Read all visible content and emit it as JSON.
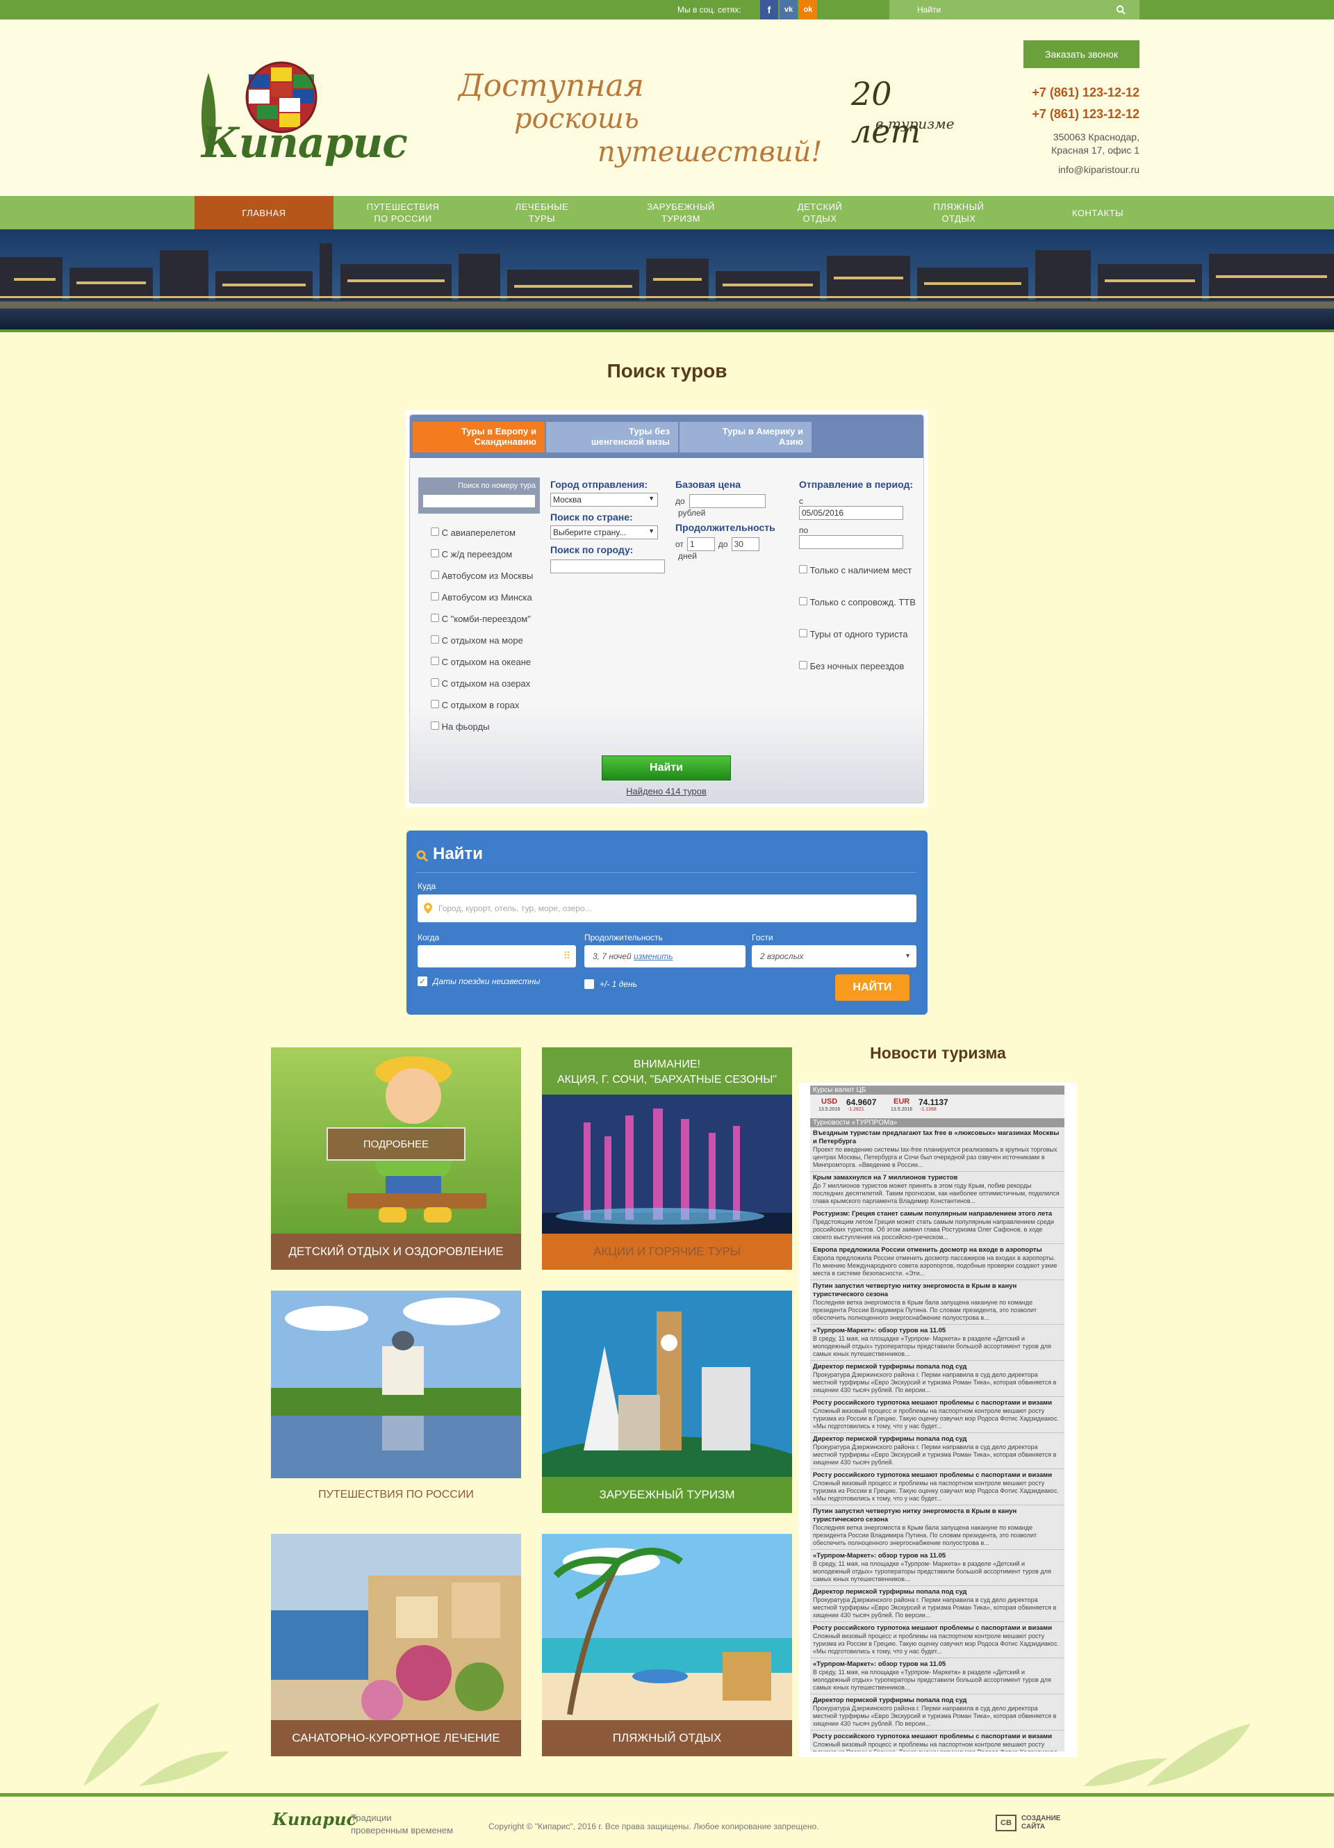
{
  "topbar": {
    "social_label": "Мы в соц. сетях:",
    "search_placeholder": "Найти"
  },
  "header": {
    "logo_text": "Кипарис",
    "slogan_lines": [
      "Доступная",
      "роскошь",
      "путешествий!"
    ],
    "years_badge_main": "20 лет",
    "years_badge_sub": "в туризме",
    "callback_button": "Заказать звонок",
    "phone1": "+7 (861) 123-12-12",
    "phone2": "+7 (861) 123-12-12",
    "address_line1": "350063 Краснодар,",
    "address_line2": "Красная 17, офис 1",
    "email": "info@kiparistour.ru"
  },
  "menu": [
    {
      "label": "Главная"
    },
    {
      "label": "Путешествия\nпо России"
    },
    {
      "label": "Лечебные\nтуры"
    },
    {
      "label": "Зарубежный\nтуризм"
    },
    {
      "label": "Детский\nотдых"
    },
    {
      "label": "Пляжный\nотдых"
    },
    {
      "label": "Контакты"
    }
  ],
  "search_section": {
    "title": "Поиск туров",
    "tabs": [
      "Туры в Европу и Скандинавию",
      "Туры без шенгенской визы",
      "Туры в Америку и Азию"
    ],
    "tour_number_label": "Поиск по номеру тура",
    "transport_options": [
      "С авиаперелетом",
      "С ж/д переездом",
      "Автобусом из Москвы",
      "Автобусом из Минска",
      "С \"комби-переездом\"",
      "С отдыхом на море",
      "С отдыхом на океане",
      "С отдыхом на озерах",
      "С отдыхом в горах",
      "На фьорды"
    ],
    "departure_city_label": "Город отправления:",
    "departure_city_value": "Москва",
    "country_label": "Поиск по стране:",
    "country_value": "Выберите страну...",
    "city_label": "Поиск по городу:",
    "price_label": "Базовая цена",
    "price_to": "до",
    "price_unit": "рублей",
    "duration_label": "Продолжительность",
    "duration_from": "от",
    "duration_from_value": "1",
    "duration_to": "до",
    "duration_to_value": "30",
    "duration_unit": "дней",
    "period_label": "Отправление в период:",
    "period_from_label": "с",
    "period_from_value": "05/05/2016",
    "period_to_label": "по",
    "extra_options": [
      "Только с наличием мест",
      "Только с сопровожд. ТТВ",
      "Туры от одного туриста",
      "Без ночных переездов"
    ],
    "find_button": "Найти",
    "found_text": "Найдено 414 туров"
  },
  "widget": {
    "title": "Найти",
    "where_label": "Куда",
    "where_placeholder": "Город, курорт, отель, тур, море, озеро...",
    "when_label": "Когда",
    "duration_label": "Продолжительность",
    "duration_value": "3, 7 ночей",
    "duration_change": "изменить",
    "guests_label": "Гости",
    "guests_value": "2 взрослых",
    "unknown_dates": "Даты поездки неизвестны",
    "plus_minus": "+/- 1 день",
    "find_button": "НАЙТИ"
  },
  "tiles": [
    {
      "caption": "Детский отдых и оздоровление",
      "more_button": "Подробнее"
    },
    {
      "caption": "Акции и горячие туры",
      "promo_line1": "ВНИМАНИЕ!",
      "promo_line2": "АКЦИЯ,  Г. СОЧИ, \"БАРХАТНЫЕ СЕЗОНЫ\""
    },
    {
      "caption": "Путешествия по России"
    },
    {
      "caption": "Зарубежный туризм"
    },
    {
      "caption": "Санаторно-курортное лечение"
    },
    {
      "caption": "Пляжный отдых"
    }
  ],
  "news": {
    "title": "Новости туризма",
    "rates_header": "Курсы валют ЦБ",
    "usd_label": "USD",
    "usd_date": "13.5.2016",
    "usd_value": "64.9607",
    "usd_change": "-1.2821",
    "eur_label": "EUR",
    "eur_date": "13.5.2016",
    "eur_value": "74.1137",
    "eur_change": "-1.1368",
    "feed_header": "Турновости «ТУРПРОМа»",
    "items": [
      {
        "title": "Въездным туристам предлагают tax free в «люксовых» магазинах Москвы и Петербурга",
        "text": "Проект по введению системы tax-free планируется реализовать в крупных торговых центрах Москвы, Петербурга и Сочи был очередной раз озвучен источниками в Минпромторга. «Введение в России..."
      },
      {
        "title": "Крым замахнулся на 7 миллионов туристов",
        "text": "До 7 миллионов туристов может принять в этом году Крым, побив рекорды последних десятилетий. Таким прогнозом, как наиболее оптимистичным, поделился глава крымского парламента Владимир Константинов..."
      },
      {
        "title": "Ростуризм: Греция станет самым популярным направлением этого лета",
        "text": "Предстоящим летом Греция может стать самым популярным направлением среди российских туристов. Об этом заявил глава Ростуризма Олег Сафонов, в ходе своего выступления на российско-греческом..."
      },
      {
        "title": "Европа предложила России отменить досмотр на входе в аэропорты",
        "text": "Европа предложила России отменить досмотр пассажиров на входах в аэропорты. По мнению Международного совета аэропортов, подобные проверки создают узкие места в системе безопасности. «Эти..."
      },
      {
        "title": "Путин запустил четвертую нитку энергомоста в Крым в канун туристического сезона",
        "text": "Последняя ветка энергомоста в Крым бала запущена накануне по команде президента России Владимира Путина. По словам президента, это позволит обеспечить полноценного энергоснабжение полуострова в..."
      },
      {
        "title": "«Турпром-Маркет»: обзор туров на 11.05",
        "text": "В среду, 11 мая, на площадке «Турпром- Маркета» в разделе «Детский и молодежный отдых» туроператоры представили большой ассортимент туров для самых юных путешественников..."
      },
      {
        "title": "Директор пермской турфирмы попала под суд",
        "text": "Прокуратура Дзержинского района г. Перми направила в суд дело директора местной турфирмы «Евро Экскурсий и туризма Роман Тика», которая обвиняется в хищении 430 тысяч рублей. По версии..."
      },
      {
        "title": "Росту российского турпотока мешают проблемы с паспортами и визами",
        "text": "Сложный визовый процесс и проблемы на паспортном контроле мешают росту туризма из России в Грецию. Такую оценку озвучил мэр Родоса Фотис Хадзидиакос. «Мы подготовились к тому, что у нас будет..."
      },
      {
        "title": "Директор пермской турфирмы попала под суд",
        "text": "Прокуратура Дзержинского района г. Перми направила в суд дело директора местной турфирмы «Евро Экскурсий и туризма Роман Тика», которая обвиняется в хищении 430 тысяч рублей."
      },
      {
        "title": "Росту российского турпотока мешают проблемы с паспортами и визами",
        "text": "Сложный визовый процесс и проблемы на паспортном контроле мешают росту туризма из России в Грецию. Такую оценку озвучил мэр Родоса Фотис Хадзидиакос. «Мы подготовились к тому, что у нас будет..."
      },
      {
        "title": "Путин запустил четвертую нитку энергомоста в Крым в канун туристического сезона",
        "text": "Последняя ветка энергомоста в Крым бала запущена накануне по команде президента России Владимира Путина. По словам президента, это позволит обеспечить полноценного энергоснабжение полуострова в..."
      },
      {
        "title": "«Турпром-Маркет»: обзор туров на 11.05",
        "text": "В среду, 11 мая, на площадке «Турпром- Маркета» в разделе «Детский и молодежный отдых» туроператоры представили большой ассортимент туров для самых юных путешественников..."
      },
      {
        "title": "Директор пермской турфирмы попала под суд",
        "text": "Прокуратура Дзержинского района г. Перми направила в суд дело директора местной турфирмы «Евро Экскурсий и туризма Роман Тика», которая обвиняется в хищении 430 тысяч рублей. По версии..."
      },
      {
        "title": "Росту российского турпотока мешают проблемы с паспортами и визами",
        "text": "Сложный визовый процесс и проблемы на паспортном контроле мешают росту туризма из России в Грецию. Такую оценку озвучил мэр Родоса Фотис Хадзидиакос. «Мы подготовились к тому, что у нас будет..."
      },
      {
        "title": "«Турпром-Маркет»: обзор туров на 11.05",
        "text": "В среду, 11 мая, на площадке «Турпром- Маркета» в разделе «Детский и молодежный отдых» туроператоры представили большой ассортимент туров для самых юных путешественников..."
      },
      {
        "title": "Директор пермской турфирмы попала под суд",
        "text": "Прокуратура Дзержинского района г. Перми направила в суд дело директора местной турфирмы «Евро Экскурсий и туризма Роман Тика», которая обвиняется в хищении 430 тысяч рублей. По версии..."
      },
      {
        "title": "Росту российского турпотока мешают проблемы с паспортами и визами",
        "text": "Сложный визовый процесс и проблемы на паспортном контроле мешают росту туризма из России в Грецию. Такую оценку озвучил мэр Родоса Фотис Хадзидиакос. «Мы подготовились к тому, что у нас будет..."
      }
    ]
  },
  "footer": {
    "logo_text": "Кипарис",
    "tagline_line1": "Традиции",
    "tagline_line2": "проверенным  временем",
    "copyright": "Copyright © \"Кипарис\", 2016 г.  Все права защищены. Любое копирование запрещено.",
    "dev_line1": "СОЗДАНИЕ",
    "dev_line2": "САЙТА"
  },
  "colors": {
    "green": "#6aa13a",
    "menu_green": "#8cbd5b",
    "menu_active": "#b5561a",
    "brown": "#8a5a3a",
    "orange": "#f79a1e",
    "widget_blue": "#3d7cc9",
    "page_bg": "#fdfbcf"
  }
}
